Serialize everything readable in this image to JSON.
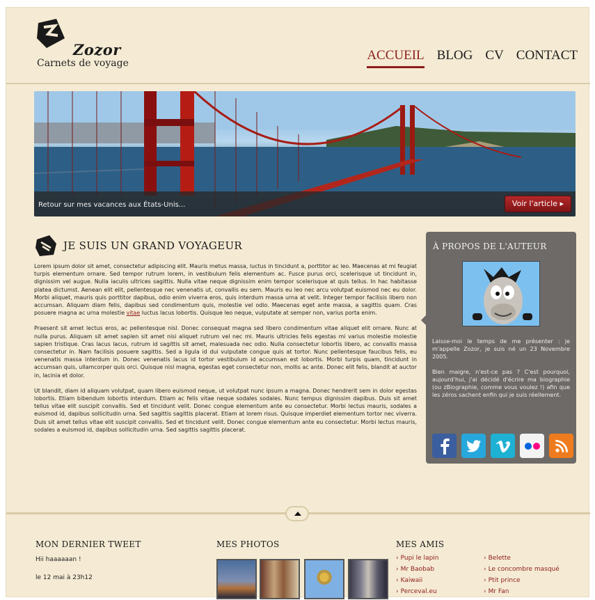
{
  "header": {
    "logo_name": "Zozor",
    "tagline": "Carnets de voyage",
    "nav": [
      {
        "label": "ACCUEIL",
        "active": true
      },
      {
        "label": "BLOG",
        "active": false
      },
      {
        "label": "CV",
        "active": false
      },
      {
        "label": "CONTACT",
        "active": false
      }
    ]
  },
  "banner": {
    "caption": "Retour sur mes vacances aux États-Unis...",
    "button_label": "Voir l'article ▸"
  },
  "article": {
    "title": "JE SUIS UN GRAND VOYAGEUR",
    "paragraph1_before": "Lorem ipsum dolor sit amet, consectetur adipiscing elit. Mauris metus massa, luctus in tincidunt a, porttitor ac leo. Maecenas at mi feugiat turpis elementum ornare. Sed tempor rutrum lorem, in vestibulum felis elementum ac. Fusce purus orci, scelerisque ut tincidunt in, dignissim vel augue. Nulla iaculis ultrices sagittis. Nulla vitae neque dignissim enim tempor scelerisque at quis tellus. In hac habitasse platea dictumst. Aenean elit elit, pellentesque nec venenatis ut, convallis eu sem. Mauris eu leo nec arcu volutpat euismod nec eu dolor. Morbi aliquet, mauris quis porttitor dapibus, odio enim viverra eros, quis interdum massa urna at velit. Integer tempor facilisis libero non accumsan. Aliquam diam felis, dapibus sed condimentum quis, molestie vel odio. Maecenas eget ante massa, a sagittis quam. Cras posuere magna ac urna molestie",
    "paragraph1_link": "vitae",
    "paragraph1_after": "luctus lacus lobortis. Quisque leo neque, vulputate at semper non, varius porta enim.",
    "paragraph2": "Praesent sit amet lectus eros, ac pellentesque nisl. Donec consequat magna sed libero condimentum vitae aliquet elit ornare. Nunc at nulla purus. Aliquam sit amet sapien sit amet nisi aliquet rutrum vel nec mi. Mauris ultricies felis egestas mi varius molestie molestie sapien tristique. Cras lacus lacus, rutrum id sagittis sit amet, malesuada nec odio. Nulla consectetur lobortis libero, ac convallis massa consectetur in. Nam facilisis posuere sagittis. Sed a ligula id dui vulputate congue quis at tortor. Nunc pellentesque faucibus felis, eu venenatis massa interdum in. Donec venenatis lacus id tortor vestibulum id accumsan est lobortis. Morbi turpis quam, tincidunt in accumsan quis, ullamcorper quis orci. Quisque nisl magna, egestas eget consectetur non, mollis ac ante. Donec elit felis, blandit at auctor in, lacinia et dolor.",
    "paragraph3": "Ut blandit, diam id aliquam volutpat, quam libero euismod neque, ut volutpat nunc ipsum a magna. Donec hendrerit sem in dolor egestas lobortis. Etiam bibendum lobortis interdum. Etiam ac felis vitae neque sodales sodales. Nunc tempus dignissim dapibus. Duis sit amet tellus vitae elit suscipit convallis. Sed et tincidunt velit. Donec congue elementum ante eu consectetur. Morbi lectus mauris, sodales a euismod id, dapibus sollicitudin urna. Sed sagittis sagittis placerat. Etiam at lorem risus. Quisque imperdiet elementum tortor nec viverra. Duis sit amet tellus vitae elit suscipit convallis. Sed et tincidunt velit. Donec congue elementum ante eu consectetur. Morbi lectus mauris, sodales a euismod id, dapibus sollicitudin urna. Sed sagittis sagittis placerat."
  },
  "sidebar": {
    "title": "À PROPOS DE L'AUTEUR",
    "text1": "Laisse-moi le temps de me présenter : je m'appelle Zozor, je suis né un 23 Novembre 2005.",
    "text2": "Bien maigre, n'est-ce pas ? C'est pourquoi, aujourd'hui, j'ai décidé d'écrire ma biographie (ou zBiographie, comme vous voulez !) afin que les zéros sachent enfin qui je suis réellement.",
    "social": [
      "facebook-icon",
      "twitter-icon",
      "vimeo-icon",
      "flickr-icon",
      "rss-icon"
    ]
  },
  "footer": {
    "tweet_heading": "MON DERNIER TWEET",
    "tweet_text": "Hii haaaaaan !",
    "tweet_date": "le 12 mai à 23h12",
    "photos_heading": "MES PHOTOS",
    "friends_heading": "MES AMIS",
    "friends_col1": [
      "Pupi le lapin",
      "Mr Baobab",
      "Kaiwaii",
      "Perceval.eu"
    ],
    "friends_col2": [
      "Belette",
      "Le concombre masqué",
      "Ptit prince",
      "Mr Fan"
    ]
  }
}
